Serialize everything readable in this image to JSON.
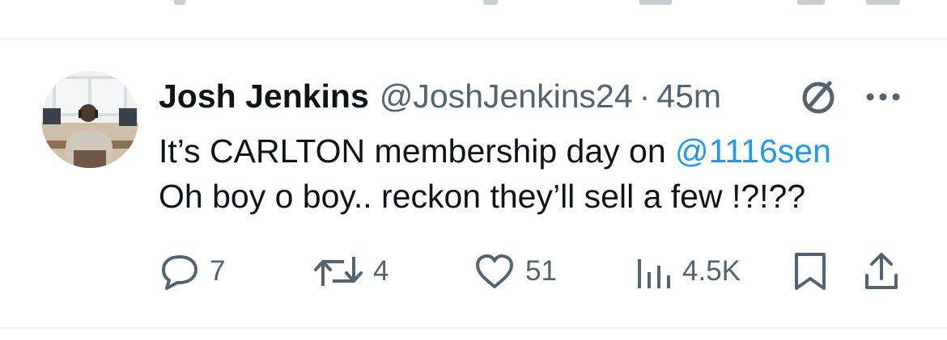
{
  "tweet": {
    "display_name": "Josh Jenkins",
    "handle": "@JoshJenkins24",
    "separator": "·",
    "time": "45m",
    "text_line1": "It’s CARLTON membership day on ",
    "mention": "@1116sen",
    "text_line2": "Oh boy o boy.. reckon they’ll sell a few !?!??"
  },
  "actions": {
    "replies": "7",
    "reposts": "4",
    "likes": "51",
    "views": "4.5K"
  },
  "icons": {
    "badge": "no-entry-circle-icon",
    "more": "more-dots-icon",
    "reply": "reply-bubble-icon",
    "repost": "repost-icon",
    "like": "heart-icon",
    "views": "views-bar-chart-icon",
    "bookmark": "bookmark-icon",
    "share": "share-icon"
  },
  "colors": {
    "text": "#0f1419",
    "secondary": "#536471",
    "link": "#1d9bf0",
    "divider": "#eff3f4"
  }
}
